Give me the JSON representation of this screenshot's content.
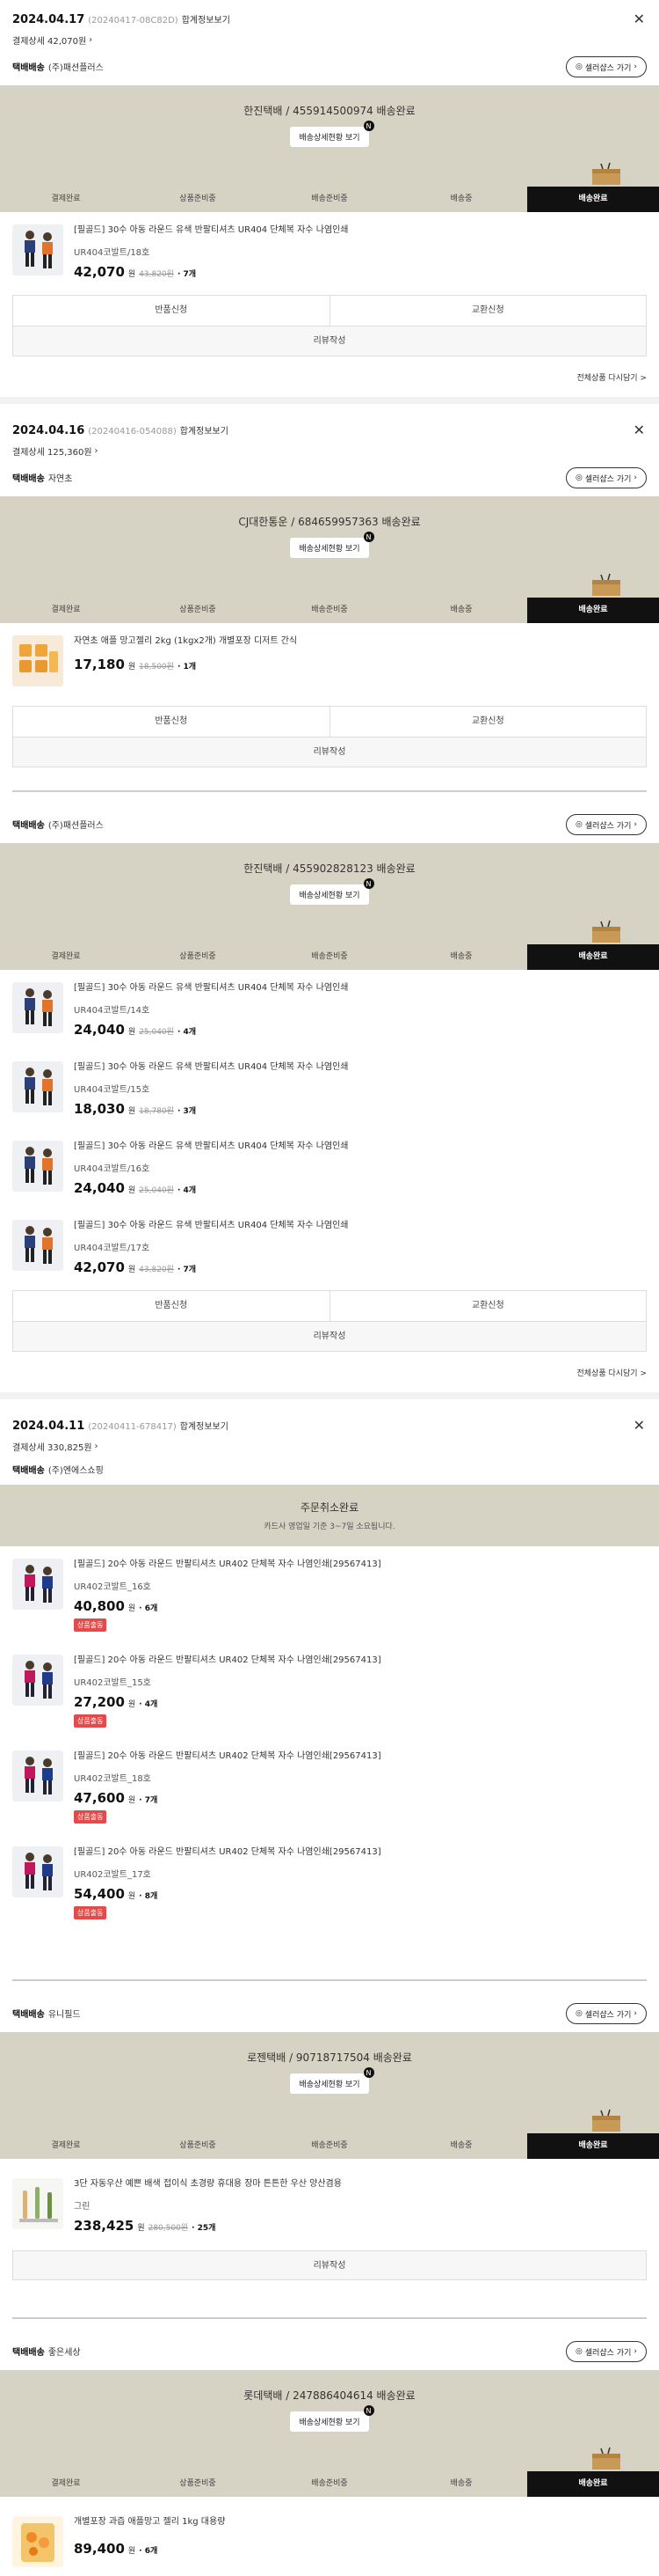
{
  "common": {
    "detail_label": "합계정보보기",
    "delivery_label": "택배배송",
    "seller_button": "셀러샵스 가기",
    "track_button": "배송상세현황 보기",
    "steps": [
      "결제완료",
      "상품준비중",
      "배송준비중",
      "배송중",
      "배송완료"
    ],
    "exchange": "반품신청",
    "exchange2": "교환신청",
    "review": "리뷰작성",
    "rebuy": "전체상품 다시담기 >",
    "won": "원",
    "prep_badge": "상품출동"
  },
  "orders": [
    {
      "date": "2024.04.17",
      "order_no": "(20240417-08C82D)",
      "pay": "결제상세 42,070원",
      "groups": [
        {
          "seller": "(주)패션플러스",
          "banner": "한진택배 / 455914500974 배송완료",
          "items": [
            {
              "brand": "필골드",
              "name": "[필골드] 30수 아동 라운드 유색 반팔티셔츠 UR404 단체복 자수 나염인쇄",
              "option": "UR404코발트/18호",
              "price": "42,070",
              "orig": "43,820원",
              "qty": "7개"
            }
          ]
        }
      ]
    },
    {
      "date": "2024.04.16",
      "order_no": "(20240416-054088)",
      "pay": "결제상세 125,360원",
      "groups": [
        {
          "seller": "자연초",
          "banner": "CJ대한통운 / 684659957363 배송완료",
          "items": [
            {
              "brand": "자연초",
              "name": "자연초 애플 망고젤리 2kg (1kgx2개) 개별포장 디저트 간식",
              "option": "",
              "price": "17,180",
              "orig": "18,500원",
              "qty": "1개"
            }
          ]
        },
        {
          "seller": "(주)패션플러스",
          "banner": "한진택배 / 455902828123 배송완료",
          "items": [
            {
              "brand": "필골드",
              "name": "[필골드] 30수 아동 라운드 유색 반팔티셔츠 UR404 단체복 자수 나염인쇄",
              "option": "UR404코발트/14호",
              "price": "24,040",
              "orig": "25,040원",
              "qty": "4개"
            },
            {
              "brand": "필골드",
              "name": "[필골드] 30수 아동 라운드 유색 반팔티셔츠 UR404 단체복 자수 나염인쇄",
              "option": "UR404코발트/15호",
              "price": "18,030",
              "orig": "18,780원",
              "qty": "3개"
            },
            {
              "brand": "필골드",
              "name": "[필골드] 30수 아동 라운드 유색 반팔티셔츠 UR404 단체복 자수 나염인쇄",
              "option": "UR404코발트/16호",
              "price": "24,040",
              "orig": "25,040원",
              "qty": "4개"
            },
            {
              "brand": "필골드",
              "name": "[필골드] 30수 아동 라운드 유색 반팔티셔츠 UR404 단체복 자수 나염인쇄",
              "option": "UR404코발트/17호",
              "price": "42,070",
              "orig": "43,820원",
              "qty": "7개"
            }
          ]
        }
      ]
    },
    {
      "date": "2024.04.11",
      "order_no": "(20240411-678417)",
      "pay": "결제상세 330,825원",
      "groups": [
        {
          "seller": "(주)엔에스쇼핑",
          "cancel_title": "주문취소완료",
          "cancel_sub": "카드사 영업일 기준 3~7일 소요됩니다.",
          "items": [
            {
              "brand": "필골드",
              "name": "[필골드] 20수 아동 라운드 반팔티셔츠 UR402 단체복 자수 나염인쇄[29567413]",
              "option": "UR402코발트_16호",
              "price": "40,800",
              "qty": "6개"
            },
            {
              "brand": "필골드",
              "name": "[필골드] 20수 아동 라운드 반팔티셔츠 UR402 단체복 자수 나염인쇄[29567413]",
              "option": "UR402코발트_15호",
              "price": "27,200",
              "qty": "4개"
            },
            {
              "brand": "필골드",
              "name": "[필골드] 20수 아동 라운드 반팔티셔츠 UR402 단체복 자수 나염인쇄[29567413]",
              "option": "UR402코발트_18호",
              "price": "47,600",
              "qty": "7개"
            },
            {
              "brand": "필골드",
              "name": "[필골드] 20수 아동 라운드 반팔티셔츠 UR402 단체복 자수 나염인쇄[29567413]",
              "option": "UR402코발트_17호",
              "price": "54,400",
              "qty": "8개"
            }
          ]
        },
        {
          "seller": "유니필드",
          "banner": "로젠택배 / 90718717504 배송완료",
          "items": [
            {
              "brand": "",
              "name": "3단 자동우산 예쁜 배색 접이식 초경량 휴대용 장마 튼튼한 우산 양산겸용",
              "option": "그린",
              "price": "238,425",
              "orig": "280,500원",
              "qty": "25개"
            }
          ]
        },
        {
          "seller": "좋은세상",
          "banner": "롯데택배 / 247886404614 배송완료",
          "items": [
            {
              "brand": "",
              "name": "개별포장 과즙 애플망고 젤리 1kg 대용량",
              "option": "",
              "price": "89,400",
              "orig": "",
              "qty": "6개"
            }
          ]
        }
      ]
    }
  ]
}
